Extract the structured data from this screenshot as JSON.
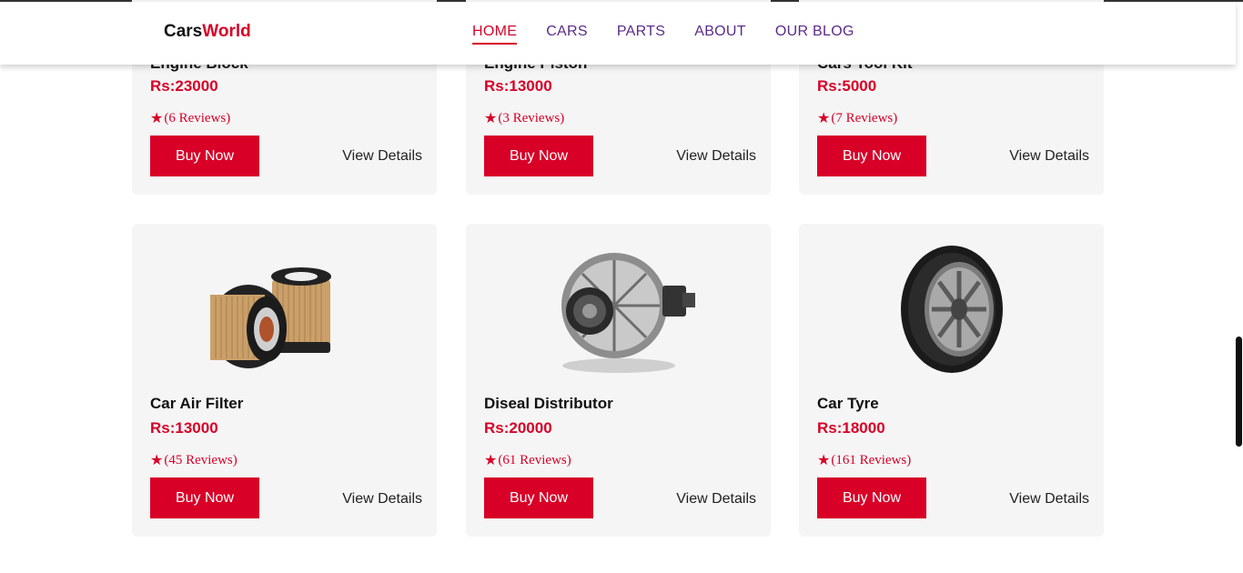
{
  "brand": {
    "part1": "Cars",
    "part2": "World"
  },
  "nav": [
    {
      "label": "HOME"
    },
    {
      "label": "CARS"
    },
    {
      "label": "PARTS"
    },
    {
      "label": "ABOUT"
    },
    {
      "label": "OUR BLOG"
    }
  ],
  "products_row1": [
    {
      "name": "Engine Block",
      "price": "Rs:23000",
      "reviews": "(6  Reviews)",
      "buy": "Buy Now",
      "view": "View Details"
    },
    {
      "name": "Engine Piston",
      "price": "Rs:13000",
      "reviews": "(3  Reviews)",
      "buy": "Buy Now",
      "view": "View Details"
    },
    {
      "name": "Cars Tool Kit",
      "price": "Rs:5000",
      "reviews": "(7  Reviews)",
      "buy": "Buy Now",
      "view": "View Details"
    }
  ],
  "products_row2": [
    {
      "name": "Car Air Filter",
      "price": "Rs:13000",
      "reviews": "(45  Reviews)",
      "buy": "Buy Now",
      "view": "View Details",
      "icon": "oil-filter-image"
    },
    {
      "name": "Diseal Distributor",
      "price": "Rs:20000",
      "reviews": "(61  Reviews)",
      "buy": "Buy Now",
      "view": "View Details",
      "icon": "alternator-image"
    },
    {
      "name": "Car Tyre",
      "price": "Rs:18000",
      "reviews": "(161  Reviews)",
      "buy": "Buy Now",
      "view": "View Details",
      "icon": "tyre-image"
    }
  ],
  "star_glyph": "★",
  "colors": {
    "accent": "#d80027",
    "nav": "#5b2a8a",
    "card": "#f5f5f5"
  }
}
